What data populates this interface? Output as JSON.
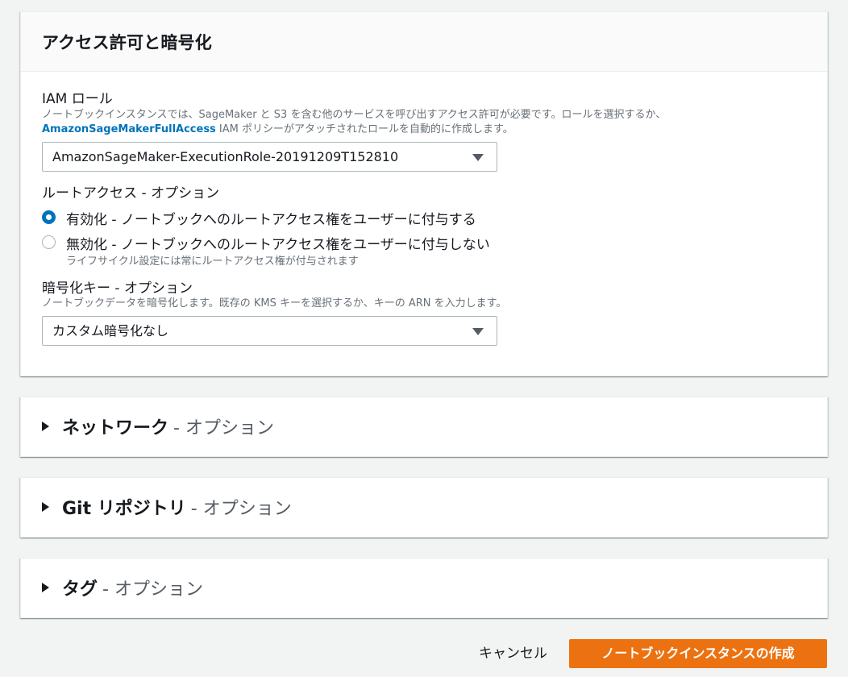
{
  "access_panel": {
    "title": "アクセス許可と暗号化",
    "iam_role": {
      "label": "IAM ロール",
      "desc_line1": "ノートブックインスタンスでは、SageMaker と S3 を含む他のサービスを呼び出すアクセス許可が必要です。ロールを選択するか、",
      "desc_link": "AmazonSageMakerFullAccess",
      "desc_line2_rest": " IAM ポリシーがアタッチされたロールを自動的に作成します。",
      "selected": "AmazonSageMaker-ExecutionRole-20191209T152810"
    },
    "root_access": {
      "label": "ルートアクセス - オプション",
      "options": [
        {
          "label": "有効化 - ノートブックへのルートアクセス権をユーザーに付与する",
          "checked": true
        },
        {
          "label": "無効化 - ノートブックへのルートアクセス権をユーザーに付与しない",
          "checked": false,
          "hint": "ライフサイクル設定には常にルートアクセス権が付与されます"
        }
      ]
    },
    "encryption_key": {
      "label": "暗号化キー - オプション",
      "desc": "ノートブックデータを暗号化します。既存の KMS キーを選択するか、キーの ARN を入力します。",
      "selected": "カスタム暗号化なし"
    }
  },
  "collapsed_sections": [
    {
      "title": "ネットワーク",
      "suffix": "- オプション"
    },
    {
      "title": "Git リポジトリ",
      "suffix": "- オプション"
    },
    {
      "title": "タグ",
      "suffix": "- オプション"
    }
  ],
  "footer": {
    "cancel_label": "キャンセル",
    "create_label": "ノートブックインスタンスの作成"
  },
  "colors": {
    "accent": "#0073bb",
    "primary_button": "#ec7211",
    "background": "#f2f3f3"
  }
}
